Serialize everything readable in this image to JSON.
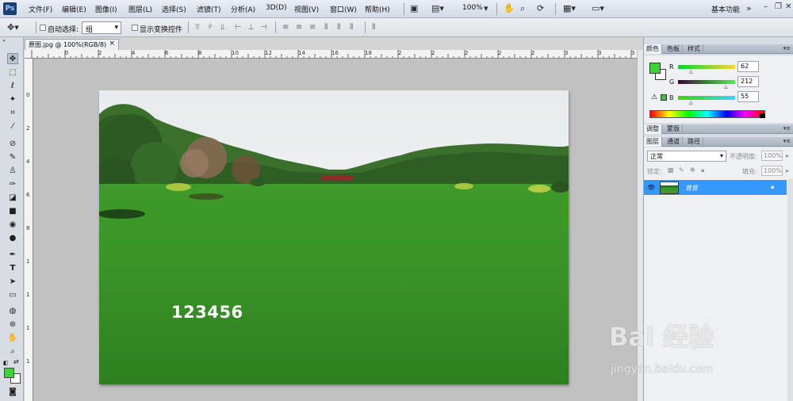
{
  "menubar": {
    "logo": "Ps",
    "items": [
      {
        "label": "文件(F)"
      },
      {
        "label": "编辑(E)"
      },
      {
        "label": "图像(I)"
      },
      {
        "label": "图层(L)"
      },
      {
        "label": "选择(S)"
      },
      {
        "label": "滤镜(T)"
      },
      {
        "label": "分析(A)"
      },
      {
        "label": "3D(D)"
      },
      {
        "label": "视图(V)"
      },
      {
        "label": "窗口(W)"
      },
      {
        "label": "帮助(H)"
      }
    ],
    "zoom": "100%",
    "workspace": "基本功能"
  },
  "options": {
    "auto_select_label": "自动选择:",
    "auto_select_value": "组",
    "show_transform_label": "显示变换控件"
  },
  "document": {
    "tab_title": "原图.jpg @ 100%(RGB/8)",
    "close": "×",
    "ruler_top": [
      "0",
      "2",
      "4",
      "6",
      "8",
      "10",
      "12",
      "14",
      "16",
      "18",
      "2",
      "2",
      "2",
      "2",
      "2",
      "3",
      "3",
      "3"
    ],
    "ruler_left": [
      "0",
      "2",
      "4",
      "6",
      "8",
      "1",
      "1",
      "1",
      "1"
    ],
    "caption": "123456"
  },
  "color_panel": {
    "tabs": [
      "颜色",
      "色板",
      "样式"
    ],
    "fg_color": "#3ed437",
    "channels": [
      {
        "label": "R",
        "value": "62"
      },
      {
        "label": "G",
        "value": "212"
      },
      {
        "label": "B",
        "value": "55"
      }
    ]
  },
  "adjust_panel": {
    "tabs": [
      "调整",
      "蒙版"
    ]
  },
  "layers_panel": {
    "tabs": [
      "图层",
      "通道",
      "路径"
    ],
    "blend_mode": "正常",
    "opacity_label": "不透明度:",
    "opacity_value": "100%",
    "lock_label": "锁定:",
    "fill_label": "填充:",
    "fill_value": "100%",
    "layer_name": "背景"
  },
  "watermark": {
    "logo": "Bai 经验",
    "url": "jingyan.baidu.com"
  }
}
